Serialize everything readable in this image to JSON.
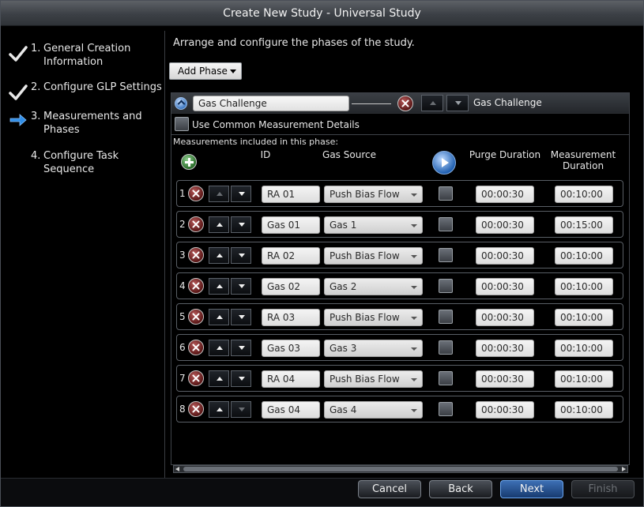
{
  "window": {
    "title": "Create New Study - Universal Study"
  },
  "sidebar": {
    "steps": [
      {
        "num": "1.",
        "label": "General Creation Information",
        "state": "done"
      },
      {
        "num": "2.",
        "label": "Configure GLP Settings",
        "state": "done"
      },
      {
        "num": "3.",
        "label": "Measurements and Phases",
        "state": "current"
      },
      {
        "num": "4.",
        "label": "Configure Task Sequence",
        "state": "pending"
      }
    ]
  },
  "main": {
    "heading": "Arrange and configure the phases of the study.",
    "add_phase_label": "Add Phase",
    "phase": {
      "name": "Gas Challenge",
      "title_right": "Gas Challenge",
      "common_label": "Use Common Measurement Details",
      "measurements_label": "Measurements included in this phase:",
      "columns": {
        "id": "ID",
        "gas_source": "Gas Source",
        "purge": "Purge Duration",
        "measurement": "Measurement Duration"
      },
      "rows": [
        {
          "index": "1",
          "id": "RA 01",
          "gas": "Push Bias Flow",
          "purge": "00:00:30",
          "duration": "00:10:00"
        },
        {
          "index": "2",
          "id": "Gas 01",
          "gas": "Gas 1",
          "purge": "00:00:30",
          "duration": "00:15:00"
        },
        {
          "index": "3",
          "id": "RA 02",
          "gas": "Push Bias Flow",
          "purge": "00:00:30",
          "duration": "00:10:00"
        },
        {
          "index": "4",
          "id": "Gas 02",
          "gas": "Gas 2",
          "purge": "00:00:30",
          "duration": "00:10:00"
        },
        {
          "index": "5",
          "id": "RA 03",
          "gas": "Push Bias Flow",
          "purge": "00:00:30",
          "duration": "00:10:00"
        },
        {
          "index": "6",
          "id": "Gas 03",
          "gas": "Gas 3",
          "purge": "00:00:30",
          "duration": "00:10:00"
        },
        {
          "index": "7",
          "id": "RA 04",
          "gas": "Push Bias Flow",
          "purge": "00:00:30",
          "duration": "00:10:00"
        },
        {
          "index": "8",
          "id": "Gas 04",
          "gas": "Gas 4",
          "purge": "00:00:30",
          "duration": "00:10:00"
        }
      ]
    }
  },
  "footer": {
    "cancel": "Cancel",
    "back": "Back",
    "next": "Next",
    "finish": "Finish"
  },
  "icons": {
    "done": "checkmark-icon",
    "current": "arrow-right-icon",
    "delete": "delete-icon",
    "add": "add-icon",
    "play": "play-icon",
    "collapse": "chevron-up-icon"
  },
  "colors": {
    "accent_blue": "#3d6fb4",
    "delete_red": "#5a1717",
    "add_green": "#2c6d2c"
  }
}
